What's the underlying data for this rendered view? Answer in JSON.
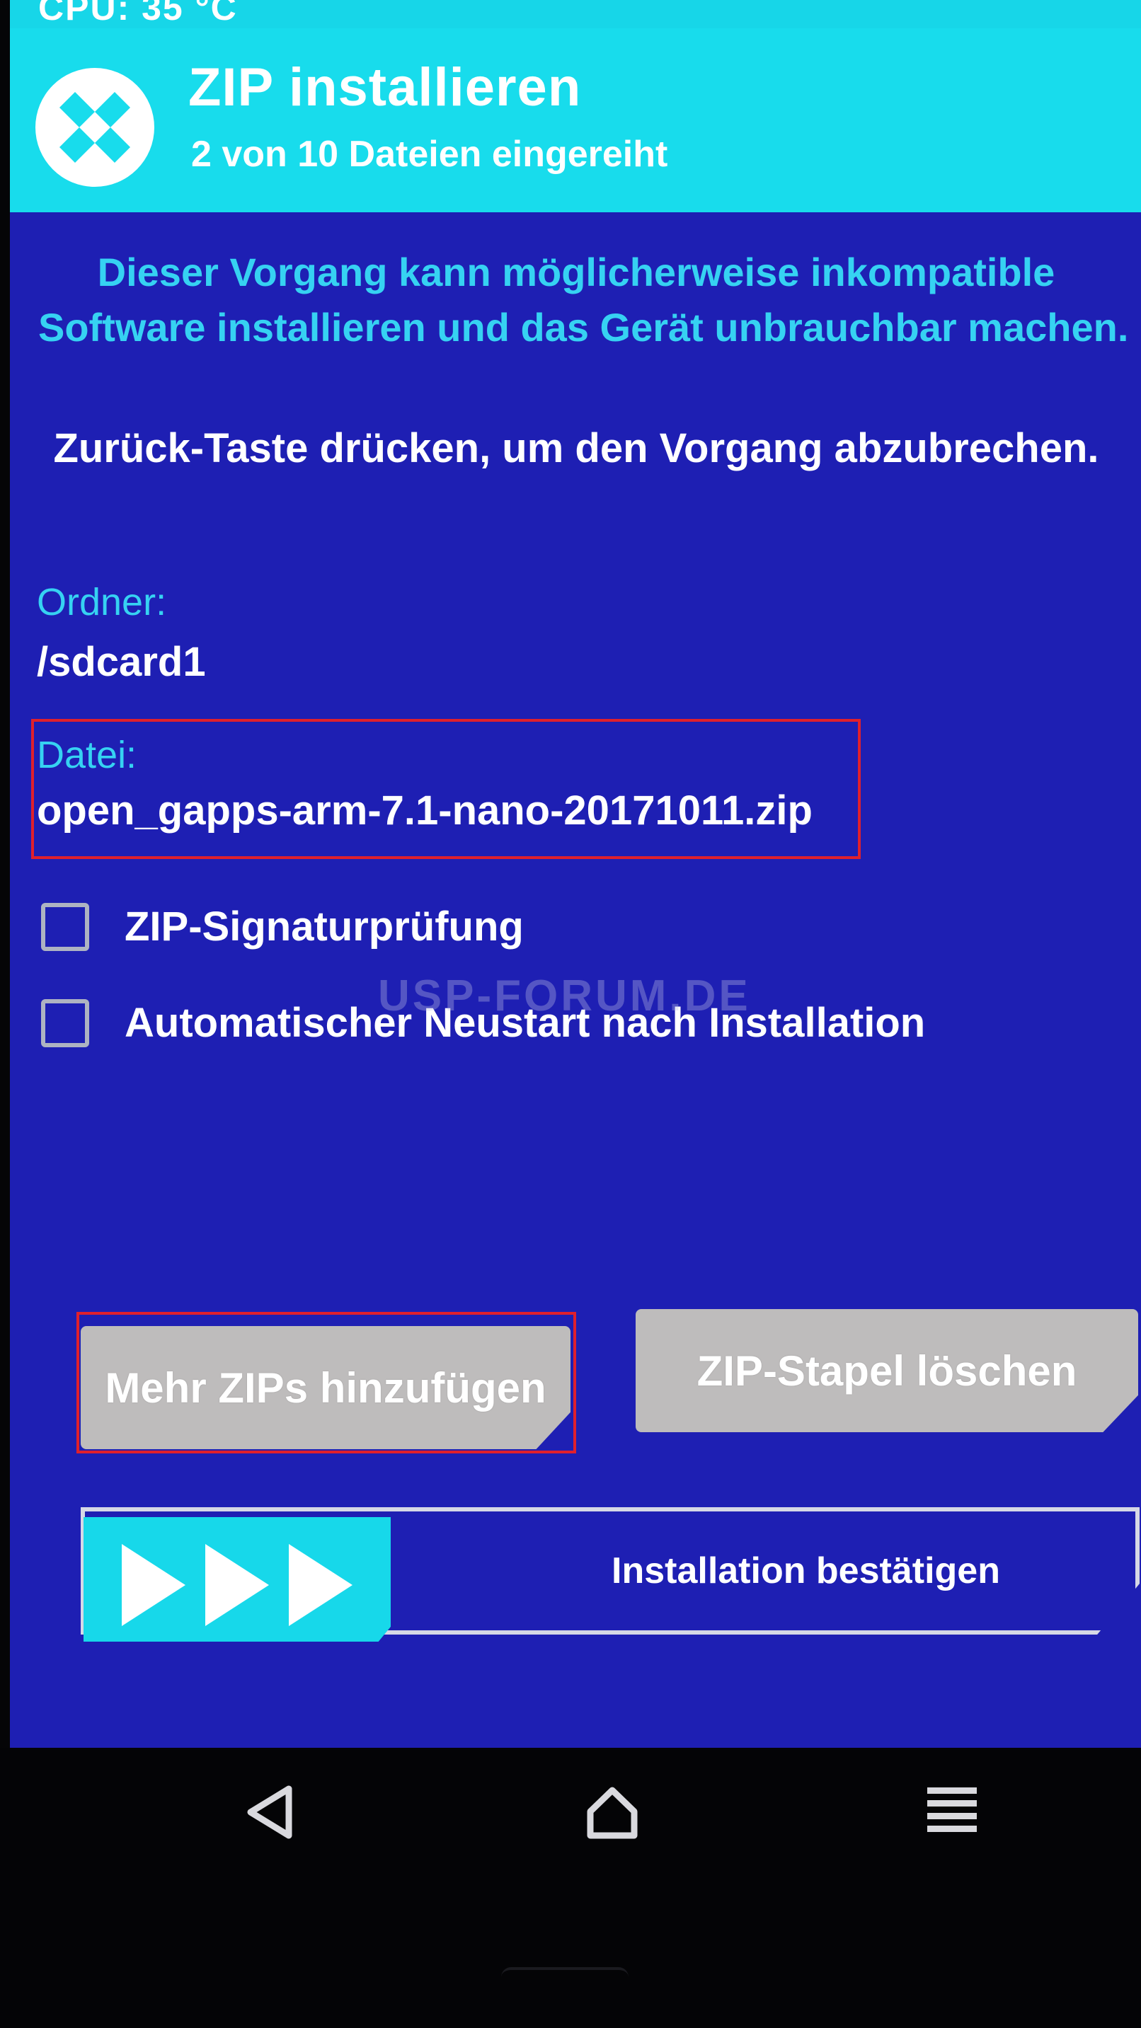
{
  "status_bar": {
    "cpu_text": "CPU: 35 °C"
  },
  "header": {
    "title": "ZIP installieren",
    "subtitle": "2 von 10 Dateien eingereiht"
  },
  "warning": {
    "line1": "Dieser Vorgang kann möglicherweise inkompatible",
    "line2": "Software installieren und das Gerät unbrauchbar machen."
  },
  "back_hint": "Zurück-Taste drücken, um den Vorgang abzubrechen.",
  "folder": {
    "label": "Ordner:",
    "value": "/sdcard1"
  },
  "file": {
    "label": "Datei:",
    "value": "open_gapps-arm-7.1-nano-20171011.zip"
  },
  "options": [
    {
      "label": "ZIP-Signaturprüfung",
      "checked": false
    },
    {
      "label": "Automatischer Neustart nach Installation",
      "checked": false
    }
  ],
  "buttons": {
    "add_more": "Mehr ZIPs hinzufügen",
    "clear_queue": "ZIP-Stapel löschen"
  },
  "swipe": {
    "label": "Installation bestätigen"
  },
  "watermark": "USP-FORUM.DE",
  "colors": {
    "background": "#1e1fb3",
    "accent": "#17d8ea",
    "info_text": "#36d2f2",
    "button": "#bebcbc",
    "highlight": "#e0202c"
  },
  "icons": {
    "logo": "twrp-logo-icon",
    "back": "back-triangle-icon",
    "home": "home-icon",
    "menu": "menu-lines-icon"
  }
}
